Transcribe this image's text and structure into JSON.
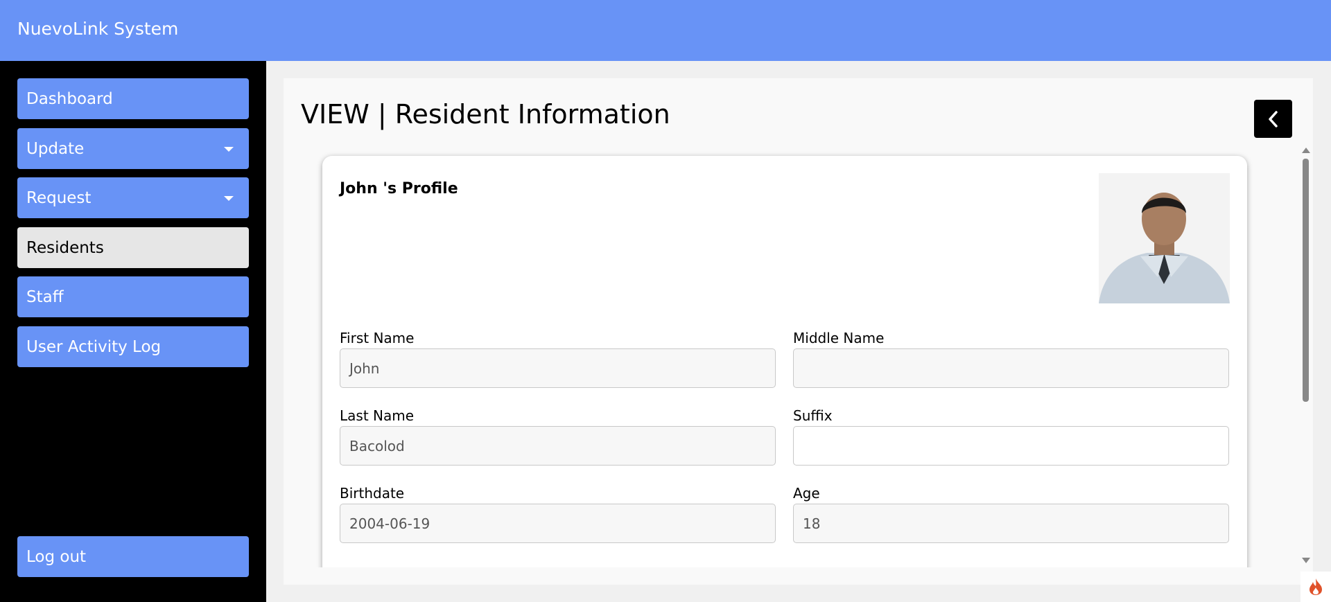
{
  "app": {
    "title": "NuevoLink System"
  },
  "sidebar": {
    "items": [
      {
        "label": "Dashboard"
      },
      {
        "label": "Update"
      },
      {
        "label": "Request"
      },
      {
        "label": "Residents"
      },
      {
        "label": "Staff"
      },
      {
        "label": "User Activity Log"
      }
    ],
    "logout_label": "Log out"
  },
  "page": {
    "title": "VIEW | Resident Information"
  },
  "profile": {
    "title": "John 's Profile",
    "fields": {
      "first_name": {
        "label": "First Name",
        "value": "John"
      },
      "middle_name": {
        "label": "Middle Name",
        "value": ""
      },
      "last_name": {
        "label": "Last Name",
        "value": "Bacolod"
      },
      "suffix": {
        "label": "Suffix",
        "value": ""
      },
      "birthdate": {
        "label": "Birthdate",
        "value": "2004-06-19"
      },
      "age": {
        "label": "Age",
        "value": "18"
      }
    }
  },
  "colors": {
    "accent": "#6893f6",
    "sidebar_bg": "#000000",
    "active_item": "#e6e6e6"
  },
  "icons": {
    "back": "chevron-left-icon",
    "dropdown": "caret-down-icon",
    "corner": "flame-icon"
  }
}
